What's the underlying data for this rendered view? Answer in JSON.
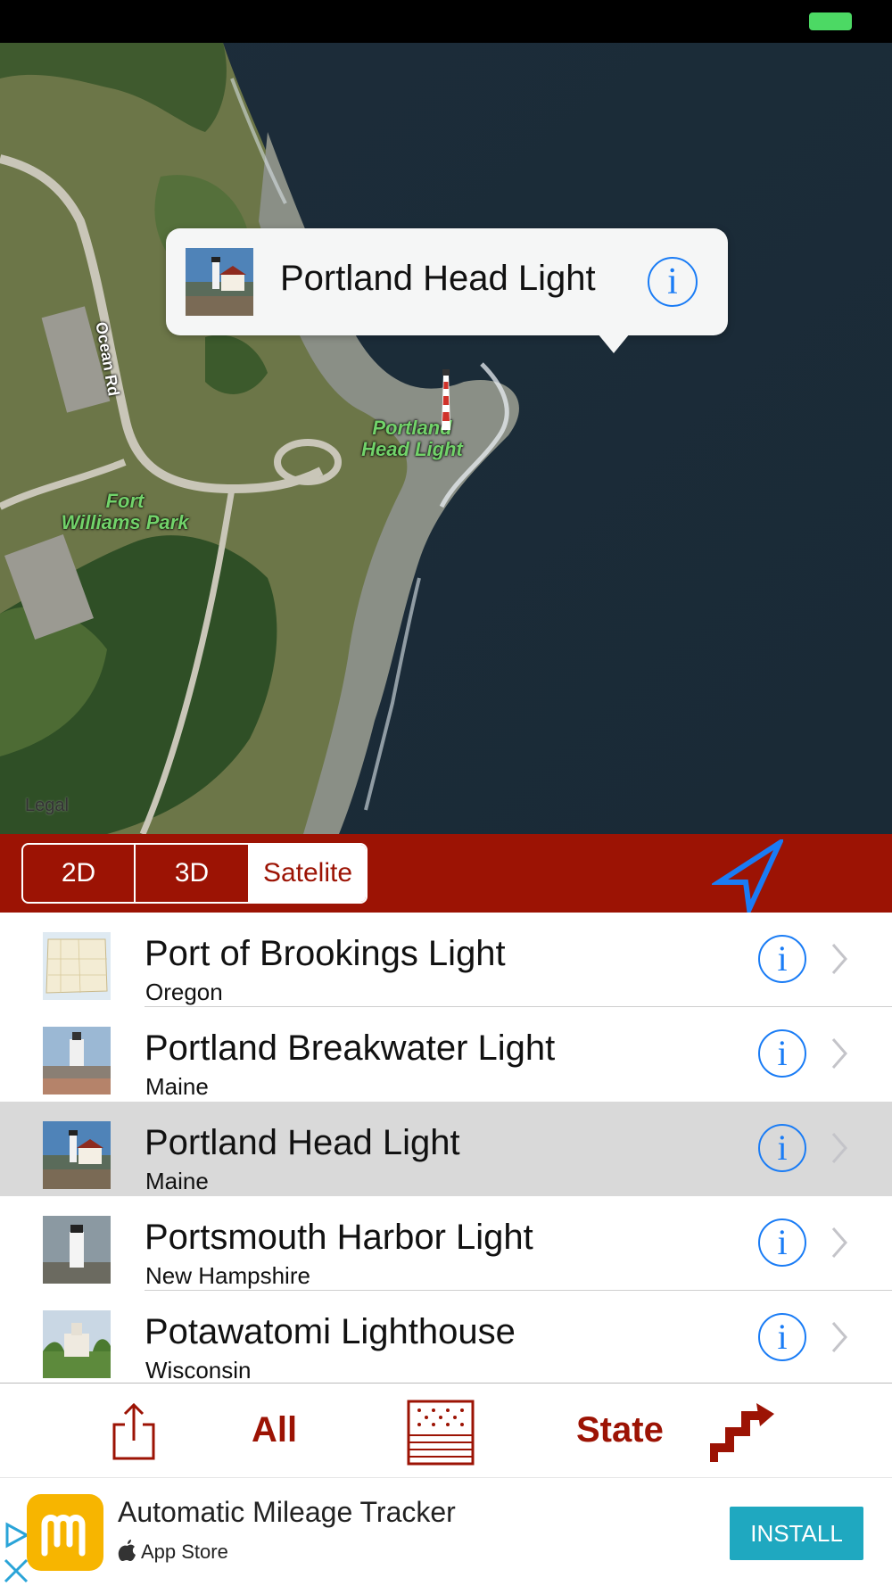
{
  "map": {
    "callout_title": "Portland Head Light",
    "labels": {
      "lighthouse": "Portland Head Light",
      "park": "Fort Williams Park",
      "road": "Ocean Rd"
    },
    "legal": "Legal"
  },
  "segment": {
    "options": [
      "2D",
      "3D",
      "Satelite"
    ],
    "selected": "Satelite"
  },
  "list": {
    "items": [
      {
        "title": "Port of Brookings Light",
        "subtitle": "Oregon",
        "thumb_icon": "oregon-map-thumbnail",
        "selected": false
      },
      {
        "title": "Portland Breakwater Light",
        "subtitle": "Maine",
        "thumb_icon": "lighthouse-photo-thumbnail",
        "selected": false
      },
      {
        "title": "Portland Head Light",
        "subtitle": "Maine",
        "thumb_icon": "lighthouse-photo-thumbnail",
        "selected": true
      },
      {
        "title": "Portsmouth Harbor Light",
        "subtitle": "New Hampshire",
        "thumb_icon": "lighthouse-photo-thumbnail",
        "selected": false
      },
      {
        "title": "Potawatomi Lighthouse",
        "subtitle": "Wisconsin",
        "thumb_icon": "lighthouse-photo-thumbnail",
        "selected": false
      }
    ],
    "info_label": "i"
  },
  "toolbar": {
    "share_icon": "share-icon",
    "all_label": "All",
    "flag_icon": "us-flag-icon",
    "state_label": "State",
    "route_icon": "route-icon"
  },
  "ad": {
    "app_title": "Automatic Mileage Tracker",
    "store": "App Store",
    "install_label": "INSTALL"
  },
  "colors": {
    "brand_red": "#9c1304",
    "info_blue": "#1a7cf5",
    "install_teal": "#1fa8c0",
    "selected_row": "#d9d9d9"
  }
}
